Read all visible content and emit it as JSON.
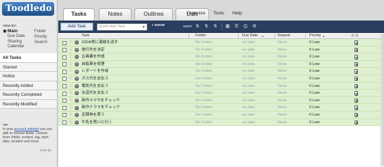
{
  "app": {
    "logo_text": "Toodledo"
  },
  "sidebar": {
    "viewby_title": "VIEW BY:",
    "col1": [
      "Main",
      "Due Date",
      "Sharing",
      "Calendar"
    ],
    "col2": [
      "Folder",
      "Priority",
      "Search"
    ],
    "filters": [
      "All Tasks",
      "Starred",
      "Hotlist",
      "Recently Added",
      "Recently Completed",
      "Recently Modified"
    ],
    "tip_title": "TIP:",
    "tip_before": "In your ",
    "tip_link": "account settings",
    "tip_after": " you can add or remove fields. Choose from: folder, context, tag, start-date, location and more.",
    "close_tip": "close tip"
  },
  "tabs": [
    "Tasks",
    "Notes",
    "Outlines",
    "Lists"
  ],
  "top_links": [
    "Organize",
    "Tools",
    "Help"
  ],
  "toolbar": {
    "add_task": "Add Task",
    "quick_add_placeholder": "Quick Add Task",
    "show": "+ SHOW",
    "sort": "SORT:"
  },
  "columns": {
    "task": "Task",
    "folder": "Folder",
    "due_date": "Due Date",
    "repeat": "Repeat",
    "priority": "Priority"
  },
  "tasks": [
    {
      "title": "GIGA男に連絡を返す",
      "folder": "No Folder",
      "due": "no date",
      "repeat": "None",
      "priority": "0 Low"
    },
    {
      "title": "旅行先を決定",
      "folder": "No Folder",
      "due": "no date",
      "repeat": "None",
      "priority": "0 Low"
    },
    {
      "title": "企画書を作成",
      "folder": "No Folder",
      "due": "no date",
      "repeat": "None",
      "priority": "0 Low"
    },
    {
      "title": "自転車を修理",
      "folder": "No Folder",
      "due": "no date",
      "repeat": "None",
      "priority": "0 Low"
    },
    {
      "title": "レポートを作成",
      "folder": "No Folder",
      "due": "no date",
      "repeat": "None",
      "priority": "0 Low"
    },
    {
      "title": "ガス代を支払う",
      "folder": "No Folder",
      "due": "no date",
      "repeat": "None",
      "priority": "0 Low"
    },
    {
      "title": "電気代を支払う",
      "folder": "No Folder",
      "due": "no date",
      "repeat": "None",
      "priority": "0 Low"
    },
    {
      "title": "水道代を支払う",
      "folder": "No Folder",
      "due": "no date",
      "repeat": "None",
      "priority": "0 Low"
    },
    {
      "title": "新作スマホをチェック",
      "folder": "No Folder",
      "due": "no date",
      "repeat": "None",
      "priority": "0 Low"
    },
    {
      "title": "新作ドラマをチェック",
      "folder": "No Folder",
      "due": "no date",
      "repeat": "None",
      "priority": "0 Low"
    },
    {
      "title": "定期券を買う",
      "folder": "No Folder",
      "due": "no date",
      "repeat": "None",
      "priority": "0 Low"
    },
    {
      "title": "牛乳を買いに行く",
      "folder": "No Folder",
      "due": "no date",
      "repeat": "None",
      "priority": "0 Low"
    }
  ]
}
